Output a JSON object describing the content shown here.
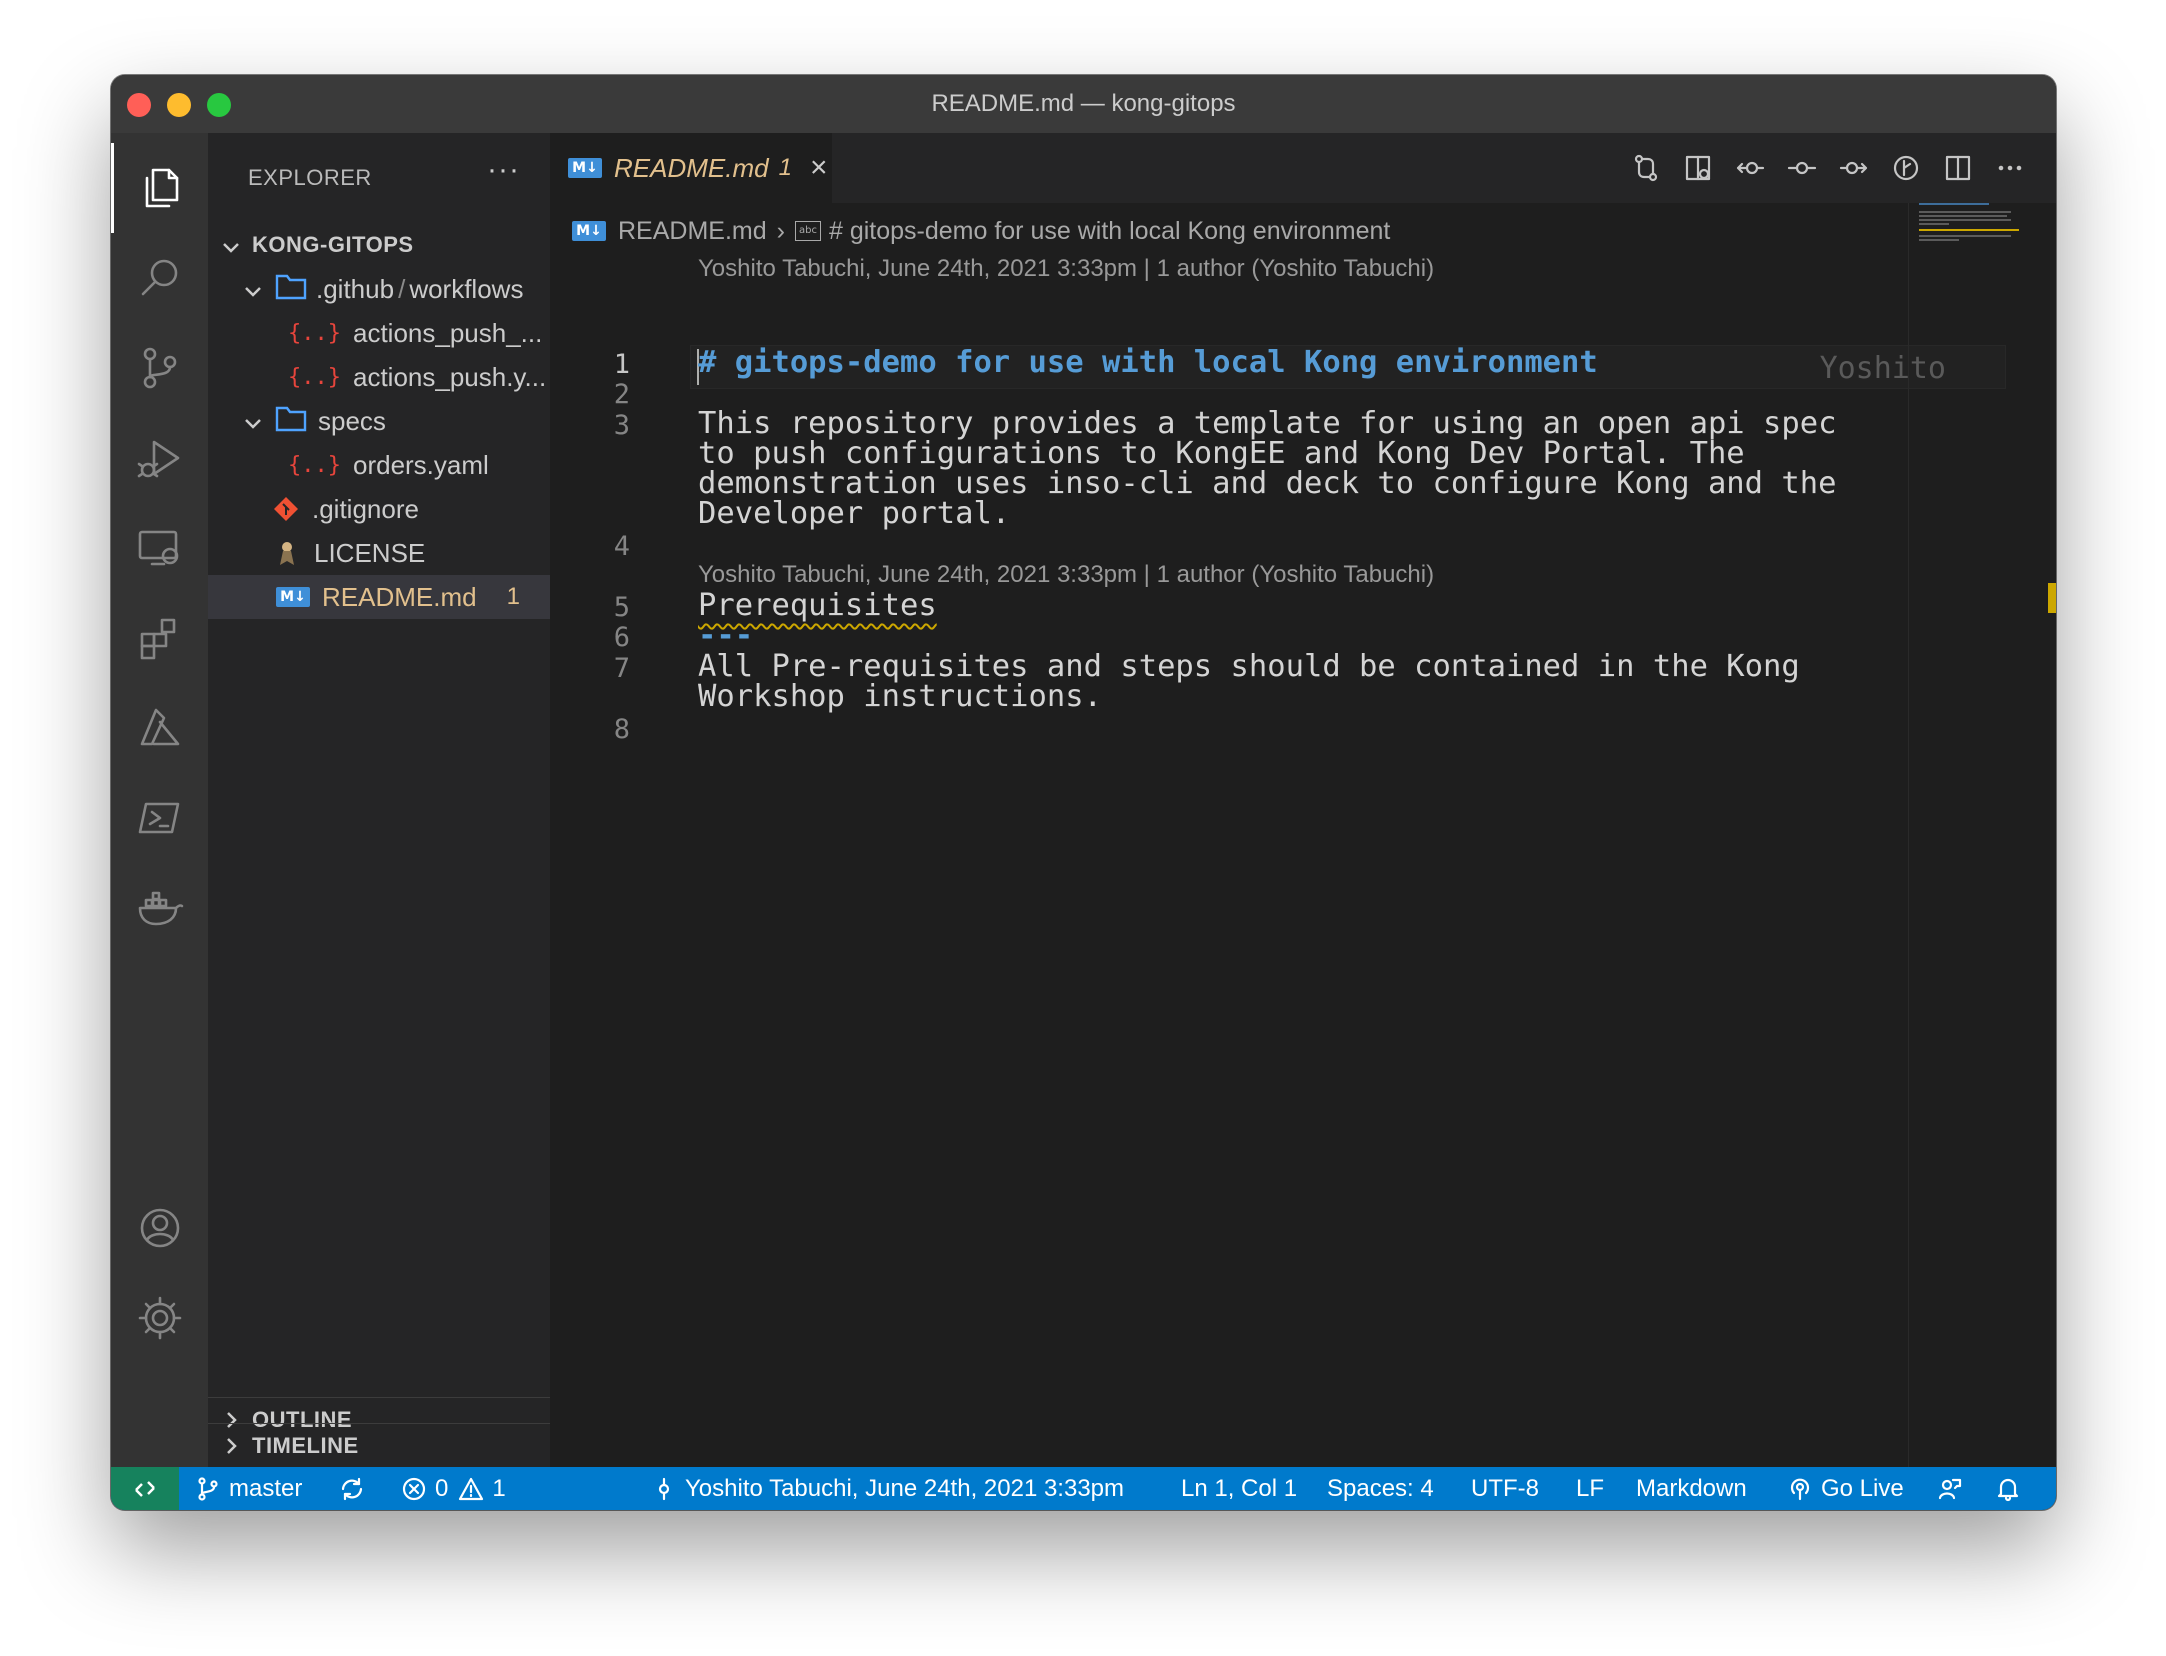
{
  "window": {
    "title": "README.md — kong-gitops"
  },
  "activity_bar": {
    "items": [
      "explorer-icon",
      "search-icon",
      "source-control-icon",
      "run-debug-icon",
      "remote-explorer-icon",
      "extensions-icon",
      "azure-icon",
      "terminal-icon",
      "docker-icon",
      "accounts-icon",
      "settings-gear-icon"
    ]
  },
  "sidebar": {
    "title": "EXPLORER",
    "more": "···",
    "root": "KONG-GITOPS",
    "tree": {
      "github_folder": ".github",
      "github_sep": "/",
      "github_sub": "workflows",
      "file1": "actions_push_...",
      "file2": "actions_push.y...",
      "specs": "specs",
      "orders": "orders.yaml",
      "gitignore": ".gitignore",
      "license": "LICENSE",
      "readme": "README.md",
      "readme_badge": "1"
    },
    "outline": "OUTLINE",
    "timeline": "TIMELINE"
  },
  "tab": {
    "name": "README.md",
    "count": "1",
    "close": "×"
  },
  "breadcrumb": {
    "file": "README.md",
    "symbol": "# gitops-demo for use with local Kong environment",
    "abc": "abc"
  },
  "editor": {
    "blame1": "Yoshito Tabuchi, June 24th, 2021 3:33pm | 1 author (Yoshito Tabuchi)",
    "blame2": "Yoshito Tabuchi, June 24th, 2021 3:33pm | 1 author (Yoshito Tabuchi)",
    "ghost_author": "Yoshito",
    "line_numbers": [
      "1",
      "2",
      "3",
      "4",
      "5",
      "6",
      "7",
      "8"
    ],
    "heading_text": "# gitops-demo for use with local Kong environment",
    "para1": [
      "This repository provides a template for using an open api spec",
      "to push configurations to KongEE and Kong Dev Portal. The",
      "demonstration uses inso-cli and deck to configure Kong and the",
      "Developer portal."
    ],
    "prereq": "Prerequisites",
    "rule": "---",
    "para2": [
      "All Pre-requisites and steps should be contained in the Kong",
      "Workshop instructions."
    ]
  },
  "status_bar": {
    "branch": "master",
    "errors": "0",
    "warnings": "1",
    "blame": "Yoshito Tabuchi, June 24th, 2021 3:33pm",
    "position": "Ln 1, Col 1",
    "spaces": "Spaces: 4",
    "encoding": "UTF-8",
    "eol": "LF",
    "language": "Markdown",
    "golive": "Go Live"
  },
  "colors": {
    "accent": "#007acc",
    "remote": "#16825d",
    "modified": "#e2c08d",
    "heading": "#569cd6",
    "folder": "#4fa3ff",
    "json": "#e8453c"
  }
}
